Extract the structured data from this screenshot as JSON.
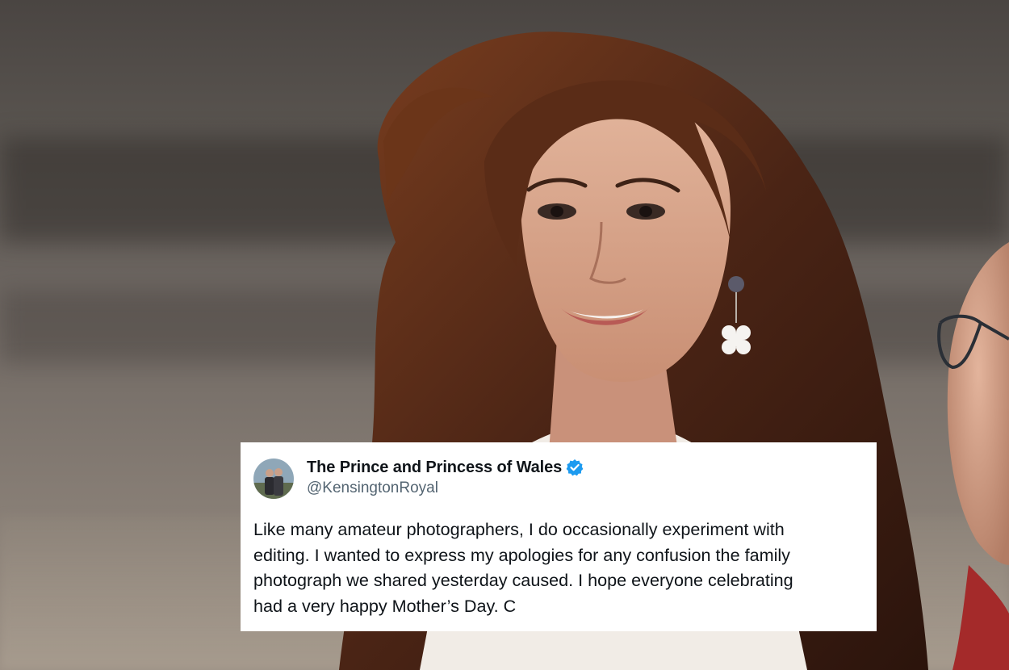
{
  "photo": {
    "description_icon": "portrait-photo",
    "colors": {
      "hair": "#4a2415",
      "skin": "#d9a58c",
      "coat": "#f1ece6",
      "background": "#5d5853"
    }
  },
  "tweet": {
    "display_name": "The Prince and Princess of Wales",
    "verified": true,
    "verified_icon": "verified-badge-icon",
    "verified_color": "#1d9bf0",
    "handle": "@KensingtonRoyal",
    "body": "Like many amateur photographers, I do occasionally experiment with\nediting. I wanted to express my apologies for any confusion the family\nphotograph we shared yesterday caused. I hope everyone celebrating\nhad a very happy Mother’s Day. C",
    "avatar_icon": "profile-avatar"
  }
}
